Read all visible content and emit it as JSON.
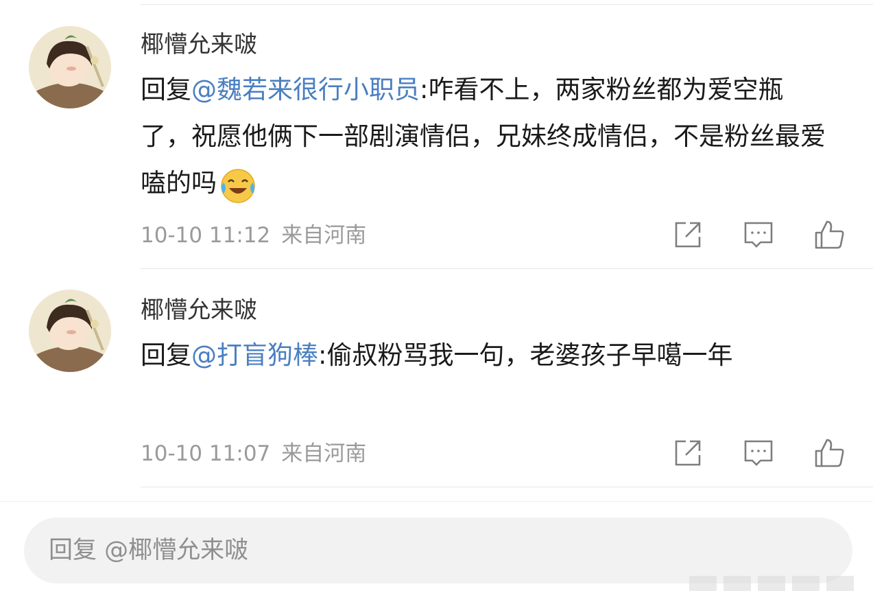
{
  "comments": [
    {
      "username": "椰懵允来啵",
      "reply_prefix": "回复",
      "mention": "@魏若来很行小职员",
      "text": ":咋看不上，两家粉丝都为爱空瓶了，祝愿他俩下一部剧演情侣，兄妹终成情侣，不是粉丝最爱嗑的吗",
      "emoji": "laughing-crying-emoji",
      "timestamp": "10-10 11:12",
      "location": "来自河南"
    },
    {
      "username": "椰懵允来啵",
      "reply_prefix": "回复",
      "mention": "@打盲狗棒",
      "text": ":偷叔粉骂我一句，老婆孩子早噶一年",
      "timestamp": "10-10 11:07",
      "location": "来自河南"
    }
  ],
  "actions": {
    "share_icon": "share-icon",
    "reply_icon": "comment-icon",
    "like_icon": "thumbs-up-icon"
  },
  "reply_input": {
    "placeholder": "回复 @椰懵允来啵"
  },
  "colors": {
    "mention": "#4a7fc1",
    "meta": "#9a9a9a",
    "input_bg": "#f2f2f2"
  }
}
